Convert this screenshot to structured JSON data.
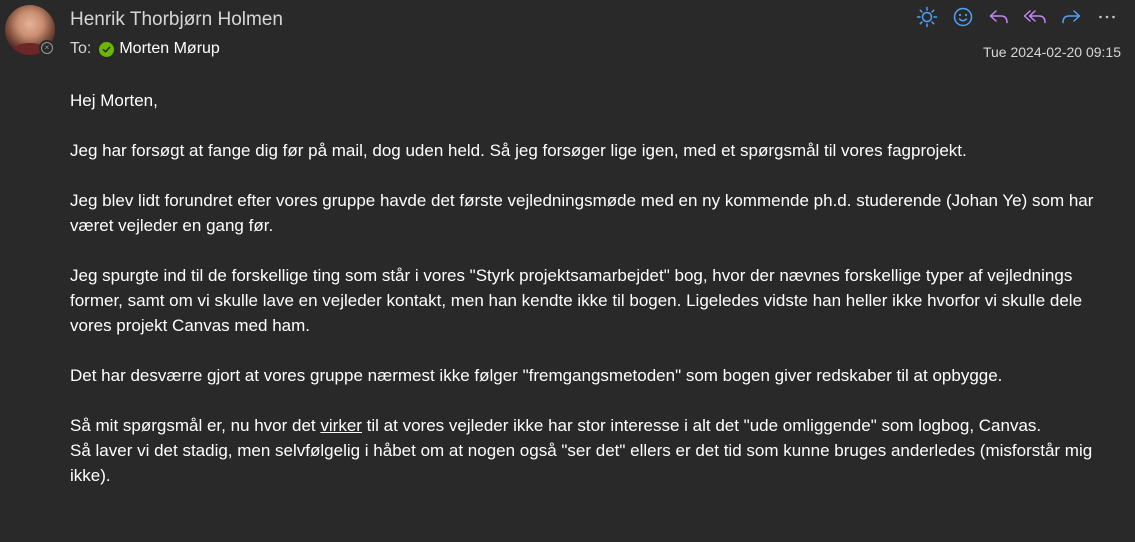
{
  "sender": {
    "name": "Henrik Thorbjørn Holmen"
  },
  "recipients": {
    "to_label": "To:",
    "name": "Morten Mørup"
  },
  "timestamp": "Tue 2024-02-20 09:15",
  "toolbar": {
    "icons": [
      "sun-icon",
      "smiley-icon",
      "reply-icon",
      "reply-all-icon",
      "forward-icon",
      "more-icon"
    ],
    "accent_color": "#4fa3f7",
    "reply_color": "#c586f5"
  },
  "message": {
    "greeting": "Hej Morten,",
    "p1": "Jeg har forsøgt at fange dig før på mail, dog uden held. Så jeg forsøger lige igen, med et spørgsmål til vores fagprojekt.",
    "p2": "Jeg blev lidt forundret efter vores gruppe havde det første vejledningsmøde med en ny kommende ph.d. studerende (Johan Ye) som har været vejleder en gang før.",
    "p3": "Jeg spurgte ind til de forskellige ting som står i vores \"Styrk projektsamarbejdet\" bog, hvor der nævnes forskellige typer af vejlednings former, samt om vi skulle lave en vejleder kontakt, men han kendte ikke til bogen. Ligeledes vidste han heller ikke hvorfor vi skulle dele vores projekt Canvas med ham.",
    "p4": "Det har desværre gjort at vores gruppe nærmest ikke følger \"fremgangsmetoden\" som bogen giver redskaber til at opbygge.",
    "p5_before": "Så mit spørgsmål er, nu hvor det ",
    "p5_underlined": "virker",
    "p5_after": " til at vores vejleder ikke har stor interesse i alt det \"ude omliggende\" som logbog, Canvas.",
    "p6": "Så laver vi det stadig, men selvfølgelig i håbet om at nogen også \"ser det\" ellers er det tid som kunne bruges anderledes (misforstår mig ikke)."
  }
}
